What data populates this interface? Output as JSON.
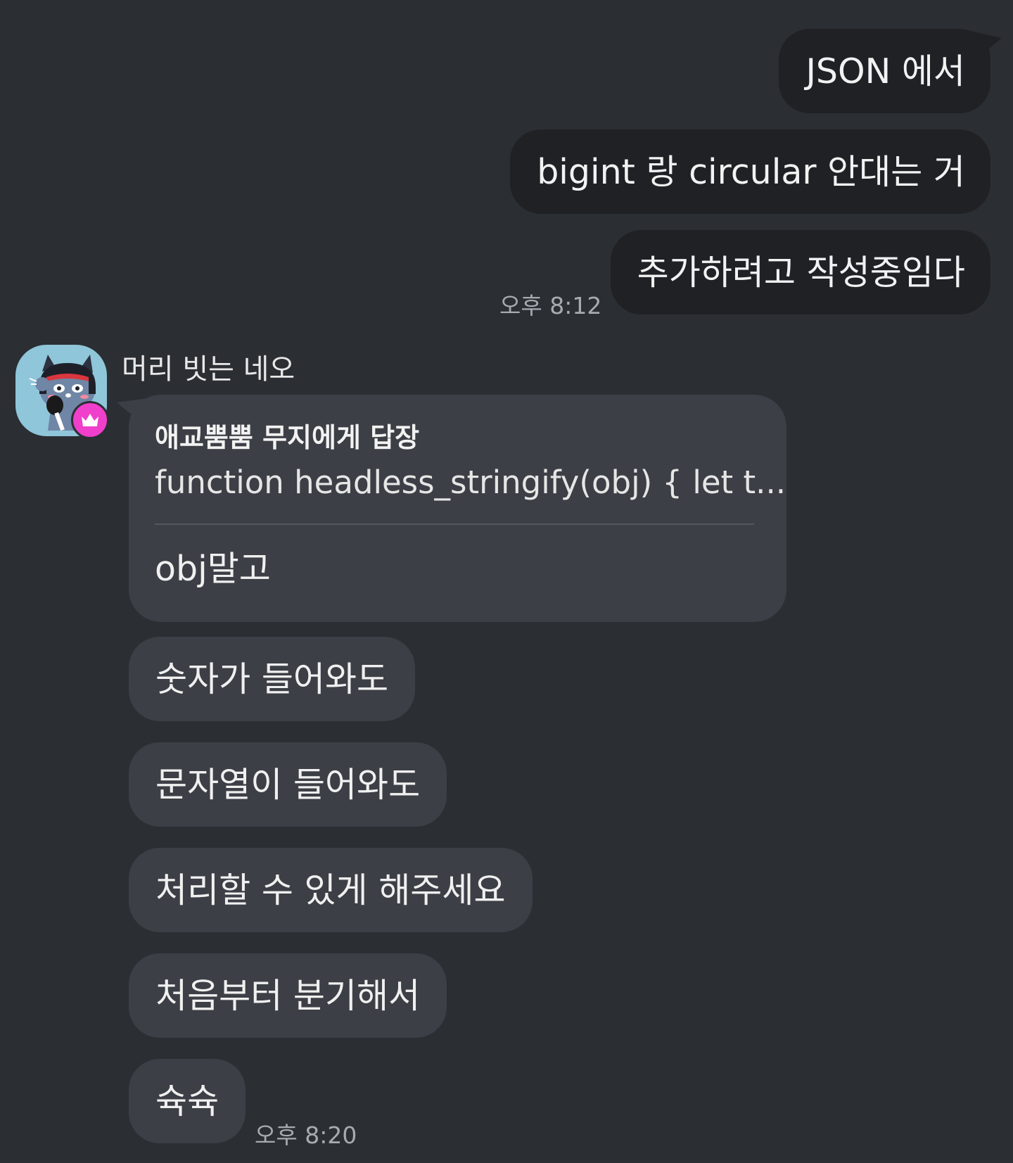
{
  "outgoing": {
    "messages": [
      "JSON 에서",
      "bigint 랑 circular 안대는 거",
      "추가하려고 작성중임다"
    ],
    "time": "오후 8:12"
  },
  "incoming": {
    "sender": "머리 빗는 네오",
    "avatar_icon": "neo-character-avatar",
    "badge_icon": "crown-icon",
    "badge_color": "#ef3fcb",
    "reply": {
      "title": "애교뿜뿜 무지에게 답장",
      "quoted": "function headless_stringify(obj) {     let t...",
      "message": "obj말고"
    },
    "messages": [
      "숫자가 들어와도",
      "문자열이 들어와도",
      "처리할 수 있게 해주세요",
      "처음부터 분기해서",
      "슉슉"
    ],
    "time": "오후 8:20"
  },
  "colors": {
    "background": "#2b2e33",
    "outgoing_bubble": "#1f2125",
    "incoming_bubble": "#3c3f45"
  }
}
